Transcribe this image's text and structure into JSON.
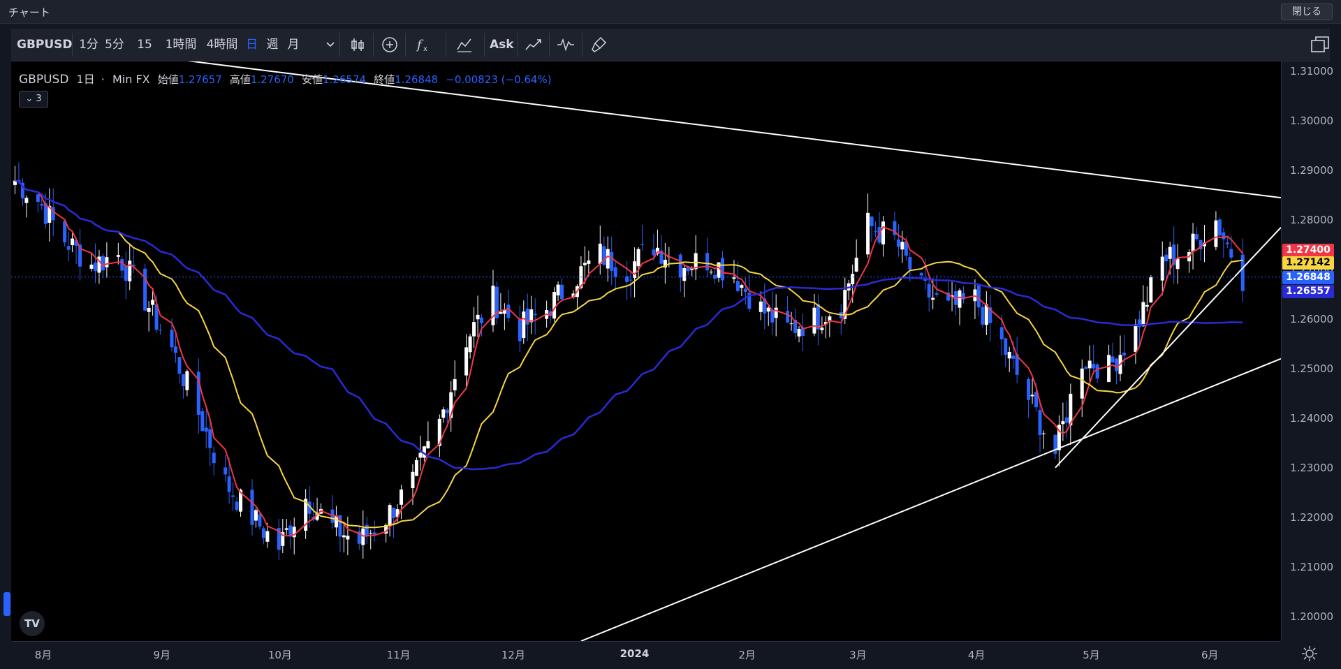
{
  "window": {
    "title": "チャート",
    "close_label": "閉じる"
  },
  "toolbar": {
    "symbol": "GBPUSD",
    "intervals": [
      "1分",
      "5分",
      "15分",
      "1時間",
      "4時間",
      "日",
      "週",
      "月"
    ],
    "active_interval": "日",
    "ask_label": "Ask",
    "icons": [
      "dropdown-chevron",
      "bar-chart-icon",
      "plus-circle-icon",
      "indicator-fx-icon",
      "compare-icon",
      "ask-label",
      "line-chart-icon",
      "oscillator-icon",
      "paintbrush-icon",
      "layout-icon"
    ]
  },
  "legend": {
    "symbol": "GBPUSD",
    "interval": "1日",
    "source": "Min FX",
    "open_label": "始値",
    "open": "1.27657",
    "high_label": "高値",
    "high": "1.27670",
    "low_label": "安値",
    "low": "1.26574",
    "close_label": "終値",
    "close": "1.26848",
    "change": "−0.00823 (−0.64%)",
    "collapsed_count": "3"
  },
  "price_axis": {
    "ticks": [
      "1.31000",
      "1.30000",
      "1.29000",
      "1.28000",
      "1.27000",
      "1.26000",
      "1.25000",
      "1.24000",
      "1.23000",
      "1.22000",
      "1.21000",
      "1.20000"
    ],
    "price_labels": [
      {
        "value": "1.27400",
        "color": "#f23645",
        "text_color": "#ffffff"
      },
      {
        "value": "1.27142",
        "color": "#f7d641",
        "text_color": "#000000"
      },
      {
        "value": "1.26848",
        "color": "#2962ff",
        "text_color": "#ffffff"
      },
      {
        "value": "1.26557",
        "color": "#2a2ad8",
        "text_color": "#ffffff"
      }
    ]
  },
  "time_axis": {
    "labels": [
      "8月",
      "9月",
      "10月",
      "11月",
      "12月",
      "2024",
      "2月",
      "3月",
      "4月",
      "5月",
      "6月"
    ]
  },
  "chart_data": {
    "type": "candlestick",
    "symbol": "GBPUSD",
    "interval": "1日",
    "ylim": [
      1.195,
      1.312
    ],
    "colors": {
      "up": "#ffffff",
      "down": "#2962ff",
      "ma_fast": "#f23645",
      "ma_mid": "#f7d641",
      "ma_slow": "#2a2ad8"
    },
    "close_path": [
      [
        "2023-07-25",
        1.288
      ],
      [
        "2023-07-31",
        1.284
      ],
      [
        "2023-08-07",
        1.276
      ],
      [
        "2023-08-14",
        1.271
      ],
      [
        "2023-08-21",
        1.273
      ],
      [
        "2023-08-28",
        1.264
      ],
      [
        "2023-09-04",
        1.254
      ],
      [
        "2023-09-11",
        1.241
      ],
      [
        "2023-09-18",
        1.227
      ],
      [
        "2023-09-25",
        1.22
      ],
      [
        "2023-10-02",
        1.214
      ],
      [
        "2023-10-09",
        1.224
      ],
      [
        "2023-10-16",
        1.218
      ],
      [
        "2023-10-23",
        1.215
      ],
      [
        "2023-10-30",
        1.22
      ],
      [
        "2023-11-06",
        1.227
      ],
      [
        "2023-11-13",
        1.239
      ],
      [
        "2023-11-20",
        1.256
      ],
      [
        "2023-11-27",
        1.264
      ],
      [
        "2023-12-04",
        1.258
      ],
      [
        "2023-12-11",
        1.262
      ],
      [
        "2023-12-18",
        1.268
      ],
      [
        "2023-12-25",
        1.273
      ],
      [
        "2024-01-01",
        1.27
      ],
      [
        "2024-01-08",
        1.275
      ],
      [
        "2024-01-15",
        1.271
      ],
      [
        "2024-01-22",
        1.272
      ],
      [
        "2024-01-29",
        1.269
      ],
      [
        "2024-02-05",
        1.262
      ],
      [
        "2024-02-12",
        1.258
      ],
      [
        "2024-02-19",
        1.26
      ],
      [
        "2024-02-26",
        1.263
      ],
      [
        "2024-03-04",
        1.279
      ],
      [
        "2024-03-11",
        1.276
      ],
      [
        "2024-03-18",
        1.266
      ],
      [
        "2024-03-25",
        1.262
      ],
      [
        "2024-04-01",
        1.264
      ],
      [
        "2024-04-08",
        1.255
      ],
      [
        "2024-04-15",
        1.244
      ],
      [
        "2024-04-22",
        1.233
      ],
      [
        "2024-04-29",
        1.252
      ],
      [
        "2024-05-06",
        1.25
      ],
      [
        "2024-05-13",
        1.258
      ],
      [
        "2024-05-20",
        1.272
      ],
      [
        "2024-05-27",
        1.274
      ],
      [
        "2024-06-03",
        1.28
      ],
      [
        "2024-06-10",
        1.2685
      ]
    ],
    "moving_averages": [
      {
        "name": "MA fast",
        "value": 1.274,
        "color": "#f23645"
      },
      {
        "name": "MA mid",
        "value": 1.27142,
        "color": "#f7d641"
      },
      {
        "name": "MA slow",
        "value": 1.26557,
        "color": "#2a2ad8"
      }
    ],
    "trendlines": [
      {
        "from": [
          "2023-07-25",
          1.3165
        ],
        "to": [
          "2024-06-20",
          1.2845
        ]
      },
      {
        "from": [
          "2023-12-20",
          1.195
        ],
        "to": [
          "2024-06-20",
          1.252
        ]
      },
      {
        "from": [
          "2024-04-22",
          1.23
        ],
        "to": [
          "2024-06-20",
          1.2785
        ]
      }
    ],
    "last_price": 1.26848
  }
}
